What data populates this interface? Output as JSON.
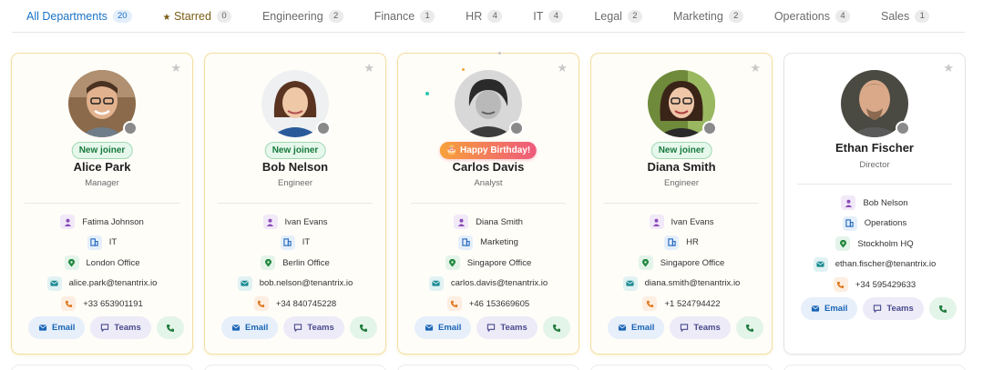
{
  "tabs": [
    {
      "label": "All Departments",
      "count": "20"
    },
    {
      "label": "Starred",
      "count": "0",
      "glyph": "★"
    },
    {
      "label": "Engineering",
      "count": "2"
    },
    {
      "label": "Finance",
      "count": "1"
    },
    {
      "label": "HR",
      "count": "4"
    },
    {
      "label": "IT",
      "count": "4"
    },
    {
      "label": "Legal",
      "count": "2"
    },
    {
      "label": "Marketing",
      "count": "2"
    },
    {
      "label": "Operations",
      "count": "4"
    },
    {
      "label": "Sales",
      "count": "1"
    }
  ],
  "colors": {
    "accent": "#1a73c7",
    "highlight_border": "#f3dfa3",
    "presence_offline": "#8a8a8a"
  },
  "cards": [
    {
      "name": "Alice Park",
      "role": "Manager",
      "badge": "New joiner",
      "manager": "Fatima Johnson",
      "department": "IT",
      "location": "London Office",
      "email": "alice.park@tenantrix.io",
      "phone": "+33 653901191",
      "btn_email": "Email",
      "btn_teams": "Teams"
    },
    {
      "name": "Bob Nelson",
      "role": "Engineer",
      "badge": "New joiner",
      "manager": "Ivan Evans",
      "department": "IT",
      "location": "Berlin Office",
      "email": "bob.nelson@tenantrix.io",
      "phone": "+34 840745228",
      "btn_email": "Email",
      "btn_teams": "Teams"
    },
    {
      "name": "Carlos Davis",
      "role": "Analyst",
      "badge": "🎂 Happy Birthday!",
      "manager": "Diana Smith",
      "department": "Marketing",
      "location": "Singapore Office",
      "email": "carlos.davis@tenantrix.io",
      "phone": "+46 153669605",
      "btn_email": "Email",
      "btn_teams": "Teams"
    },
    {
      "name": "Diana Smith",
      "role": "Engineer",
      "badge": "New joiner",
      "manager": "Ivan Evans",
      "department": "HR",
      "location": "Singapore Office",
      "email": "diana.smith@tenantrix.io",
      "phone": "+1 524794422",
      "btn_email": "Email",
      "btn_teams": "Teams"
    },
    {
      "name": "Ethan Fischer",
      "role": "Director",
      "manager": "Bob Nelson",
      "department": "Operations",
      "location": "Stockholm HQ",
      "email": "ethan.fischer@tenantrix.io",
      "phone": "+34 595429633",
      "btn_email": "Email",
      "btn_teams": "Teams"
    }
  ],
  "icons": {
    "favorite": "star-icon",
    "manager": "person-icon",
    "department": "building-icon",
    "location": "map-pin-icon",
    "email": "mail-icon",
    "phone": "phone-icon",
    "teams": "chat-icon",
    "presence": "presence-dot-icon"
  }
}
